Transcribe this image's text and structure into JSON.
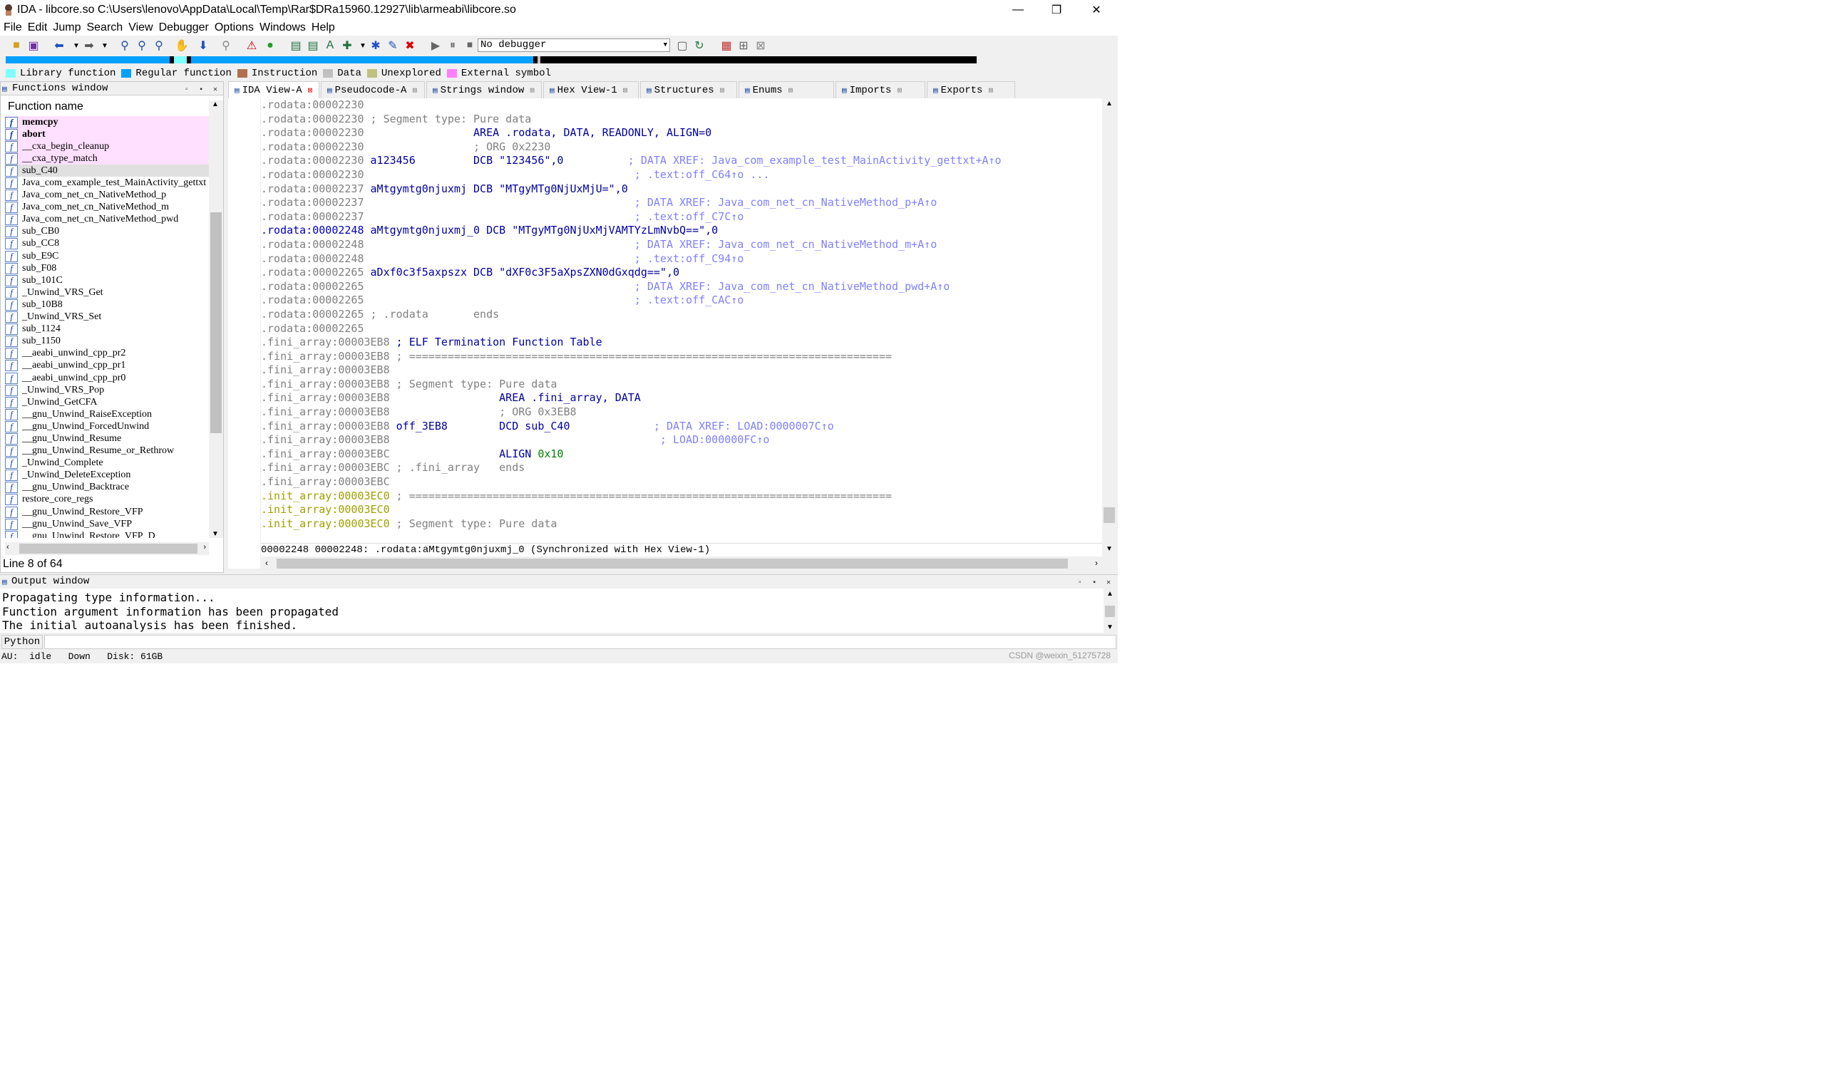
{
  "window": {
    "title": "IDA - libcore.so C:\\Users\\lenovo\\AppData\\Local\\Temp\\Rar$DRa15960.12927\\lib\\armeabi\\libcore.so",
    "minimize": "—",
    "maximize": "❐",
    "close": "✕"
  },
  "menu": [
    "File",
    "Edit",
    "Jump",
    "Search",
    "View",
    "Debugger",
    "Options",
    "Windows",
    "Help"
  ],
  "toolbar": {
    "debugger_select": "No debugger"
  },
  "legend": [
    {
      "label": "Library function",
      "color": "#7fffff"
    },
    {
      "label": "Regular function",
      "color": "#00a0ff"
    },
    {
      "label": "Instruction",
      "color": "#b07050"
    },
    {
      "label": "Data",
      "color": "#c0c0c0"
    },
    {
      "label": "Unexplored",
      "color": "#c0c080"
    },
    {
      "label": "External symbol",
      "color": "#ff80ff"
    }
  ],
  "functions_window": {
    "title": "Functions window",
    "column": "Function name",
    "status": "Line 8 of 64",
    "items": [
      {
        "name": "memcpy",
        "style": "lib bold"
      },
      {
        "name": "abort",
        "style": "lib bold"
      },
      {
        "name": "__cxa_begin_cleanup",
        "style": "lib"
      },
      {
        "name": "__cxa_type_match",
        "style": "lib"
      },
      {
        "name": "sub_C40",
        "style": "sel"
      },
      {
        "name": "Java_com_example_test_MainActivity_gettxt",
        "style": ""
      },
      {
        "name": "Java_com_net_cn_NativeMethod_p",
        "style": ""
      },
      {
        "name": "Java_com_net_cn_NativeMethod_m",
        "style": ""
      },
      {
        "name": "Java_com_net_cn_NativeMethod_pwd",
        "style": ""
      },
      {
        "name": "sub_CB0",
        "style": ""
      },
      {
        "name": "sub_CC8",
        "style": ""
      },
      {
        "name": "sub_E9C",
        "style": ""
      },
      {
        "name": "sub_F08",
        "style": ""
      },
      {
        "name": "sub_101C",
        "style": ""
      },
      {
        "name": "_Unwind_VRS_Get",
        "style": ""
      },
      {
        "name": "sub_10B8",
        "style": ""
      },
      {
        "name": "_Unwind_VRS_Set",
        "style": ""
      },
      {
        "name": "sub_1124",
        "style": ""
      },
      {
        "name": "sub_1150",
        "style": ""
      },
      {
        "name": "__aeabi_unwind_cpp_pr2",
        "style": ""
      },
      {
        "name": "__aeabi_unwind_cpp_pr1",
        "style": ""
      },
      {
        "name": "__aeabi_unwind_cpp_pr0",
        "style": ""
      },
      {
        "name": "_Unwind_VRS_Pop",
        "style": ""
      },
      {
        "name": "_Unwind_GetCFA",
        "style": ""
      },
      {
        "name": "__gnu_Unwind_RaiseException",
        "style": ""
      },
      {
        "name": "__gnu_Unwind_ForcedUnwind",
        "style": ""
      },
      {
        "name": "__gnu_Unwind_Resume",
        "style": ""
      },
      {
        "name": "__gnu_Unwind_Resume_or_Rethrow",
        "style": ""
      },
      {
        "name": "_Unwind_Complete",
        "style": ""
      },
      {
        "name": "_Unwind_DeleteException",
        "style": ""
      },
      {
        "name": "__gnu_Unwind_Backtrace",
        "style": ""
      },
      {
        "name": "restore_core_regs",
        "style": ""
      },
      {
        "name": "__gnu_Unwind_Restore_VFP",
        "style": ""
      },
      {
        "name": "__gnu_Unwind_Save_VFP",
        "style": ""
      },
      {
        "name": "__gnu_Unwind_Restore_VFP_D",
        "style": ""
      }
    ]
  },
  "tabs": [
    {
      "label": "IDA View-A",
      "active": true
    },
    {
      "label": "Pseudocode-A",
      "active": false
    },
    {
      "label": "Strings window",
      "active": false
    },
    {
      "label": "Hex View-1",
      "active": false
    },
    {
      "label": "Structures",
      "active": false
    },
    {
      "label": "Enums",
      "active": false
    },
    {
      "label": "Imports",
      "active": false
    },
    {
      "label": "Exports",
      "active": false
    }
  ],
  "disasm": [
    {
      "seg": ".rodata:00002230",
      "parts": []
    },
    {
      "seg": ".rodata:00002230",
      "parts": [
        {
          "t": " ; Segment type: Pure data",
          "c": "gry"
        }
      ]
    },
    {
      "seg": ".rodata:00002230",
      "parts": [
        {
          "t": "                 AREA .rodata, DATA, READONLY, ALIGN=0",
          "c": "kw"
        }
      ]
    },
    {
      "seg": ".rodata:00002230",
      "parts": [
        {
          "t": "                 ; ORG 0x2230",
          "c": "gry"
        }
      ]
    },
    {
      "seg": ".rodata:00002230",
      "dot": true,
      "parts": [
        {
          "t": " a123456         ",
          "c": "nm"
        },
        {
          "t": "DCB \"123456\",0",
          "c": "str"
        },
        {
          "t": "          ; DATA XREF: Java_com_example_test_MainActivity_gettxt+A↑o",
          "c": "cm"
        }
      ]
    },
    {
      "seg": ".rodata:00002230",
      "parts": [
        {
          "t": "                                          ; .text:off_C64↑o ...",
          "c": "cm"
        }
      ]
    },
    {
      "seg": ".rodata:00002237",
      "dot": true,
      "parts": [
        {
          "t": " aMtgymtg0njuxmj ",
          "c": "nm"
        },
        {
          "t": "DCB \"MTgyMTg0NjUxMjU=\",0",
          "c": "str"
        }
      ]
    },
    {
      "seg": ".rodata:00002237",
      "parts": [
        {
          "t": "                                          ; DATA XREF: Java_com_net_cn_NativeMethod_p+A↑o",
          "c": "cm"
        }
      ]
    },
    {
      "seg": ".rodata:00002237",
      "parts": [
        {
          "t": "                                          ; .text:off_C7C↑o",
          "c": "cm"
        }
      ]
    },
    {
      "seg": ".rodata:00002248",
      "dot": true,
      "hl": true,
      "parts": [
        {
          "t": " aMtgymtg0njuxmj_0 ",
          "c": "nm"
        },
        {
          "t": "DCB \"MTgyMTg0NjUxMjVAMTYzLmNvbQ==\",0",
          "c": "str"
        }
      ]
    },
    {
      "seg": ".rodata:00002248",
      "parts": [
        {
          "t": "                                          ; DATA XREF: Java_com_net_cn_NativeMethod_m+A↑o",
          "c": "cm"
        }
      ]
    },
    {
      "seg": ".rodata:00002248",
      "parts": [
        {
          "t": "                                          ; .text:off_C94↑o",
          "c": "cm"
        }
      ]
    },
    {
      "seg": ".rodata:00002265",
      "dot": true,
      "parts": [
        {
          "t": " aDxf0c3f5axpszx ",
          "c": "nm"
        },
        {
          "t": "DCB \"dXF0c3F5aXpsZXN0dGxqdg==\",0",
          "c": "str"
        }
      ]
    },
    {
      "seg": ".rodata:00002265",
      "parts": [
        {
          "t": "                                          ; DATA XREF: Java_com_net_cn_NativeMethod_pwd+A↑o",
          "c": "cm"
        }
      ]
    },
    {
      "seg": ".rodata:00002265",
      "parts": [
        {
          "t": "                                          ; .text:off_CAC↑o",
          "c": "cm"
        }
      ]
    },
    {
      "seg": ".rodata:00002265",
      "parts": [
        {
          "t": " ; .rodata       ends",
          "c": "gry"
        }
      ]
    },
    {
      "seg": ".rodata:00002265",
      "parts": []
    },
    {
      "seg": ".fini_array:00003EB8",
      "parts": [
        {
          "t": " ; ELF Termination Function Table",
          "c": "kw"
        }
      ]
    },
    {
      "seg": ".fini_array:00003EB8",
      "parts": [
        {
          "t": " ; ===========================================================================",
          "c": "gry"
        }
      ]
    },
    {
      "seg": ".fini_array:00003EB8",
      "parts": []
    },
    {
      "seg": ".fini_array:00003EB8",
      "parts": [
        {
          "t": " ; Segment type: Pure data",
          "c": "gry"
        }
      ]
    },
    {
      "seg": ".fini_array:00003EB8",
      "parts": [
        {
          "t": "                 AREA .fini_array, DATA",
          "c": "kw"
        }
      ]
    },
    {
      "seg": ".fini_array:00003EB8",
      "parts": [
        {
          "t": "                 ; ORG 0x3EB8",
          "c": "gry"
        }
      ]
    },
    {
      "seg": ".fini_array:00003EB8",
      "dot": true,
      "parts": [
        {
          "t": " off_3EB8        ",
          "c": "nm"
        },
        {
          "t": "DCD sub_C40",
          "c": "str"
        },
        {
          "t": "             ; DATA XREF: LOAD:0000007C↑o",
          "c": "cm"
        }
      ]
    },
    {
      "seg": ".fini_array:00003EB8",
      "parts": [
        {
          "t": "                                          ; LOAD:000000FC↑o",
          "c": "cm"
        }
      ]
    },
    {
      "seg": ".fini_array:00003EBC",
      "dot": true,
      "parts": [
        {
          "t": "                 ALIGN ",
          "c": "kw"
        },
        {
          "t": "0x10",
          "c": "grn"
        }
      ]
    },
    {
      "seg": ".fini_array:00003EBC",
      "parts": [
        {
          "t": " ; .fini_array   ends",
          "c": "gry"
        }
      ]
    },
    {
      "seg": ".fini_array:00003EBC",
      "parts": []
    },
    {
      "seg": ".init_array:00003EC0",
      "init": true,
      "parts": [
        {
          "t": " ; ===========================================================================",
          "c": "gry"
        }
      ]
    },
    {
      "seg": ".init_array:00003EC0",
      "init": true,
      "parts": []
    },
    {
      "seg": ".init_array:00003EC0",
      "init": true,
      "parts": [
        {
          "t": " ; Segment type: Pure data",
          "c": "gry"
        }
      ]
    }
  ],
  "disasm_status": "00002248 00002248: .rodata:aMtgymtg0njuxmj_0 (Synchronized with Hex View-1)",
  "output": {
    "title": "Output window",
    "lines": [
      "Propagating type information...",
      "Function argument information has been propagated",
      "The initial autoanalysis has been finished."
    ]
  },
  "python_label": "Python",
  "statusbar": "AU:  idle   Down   Disk: 61GB",
  "watermark": "CSDN @weixin_51275728"
}
